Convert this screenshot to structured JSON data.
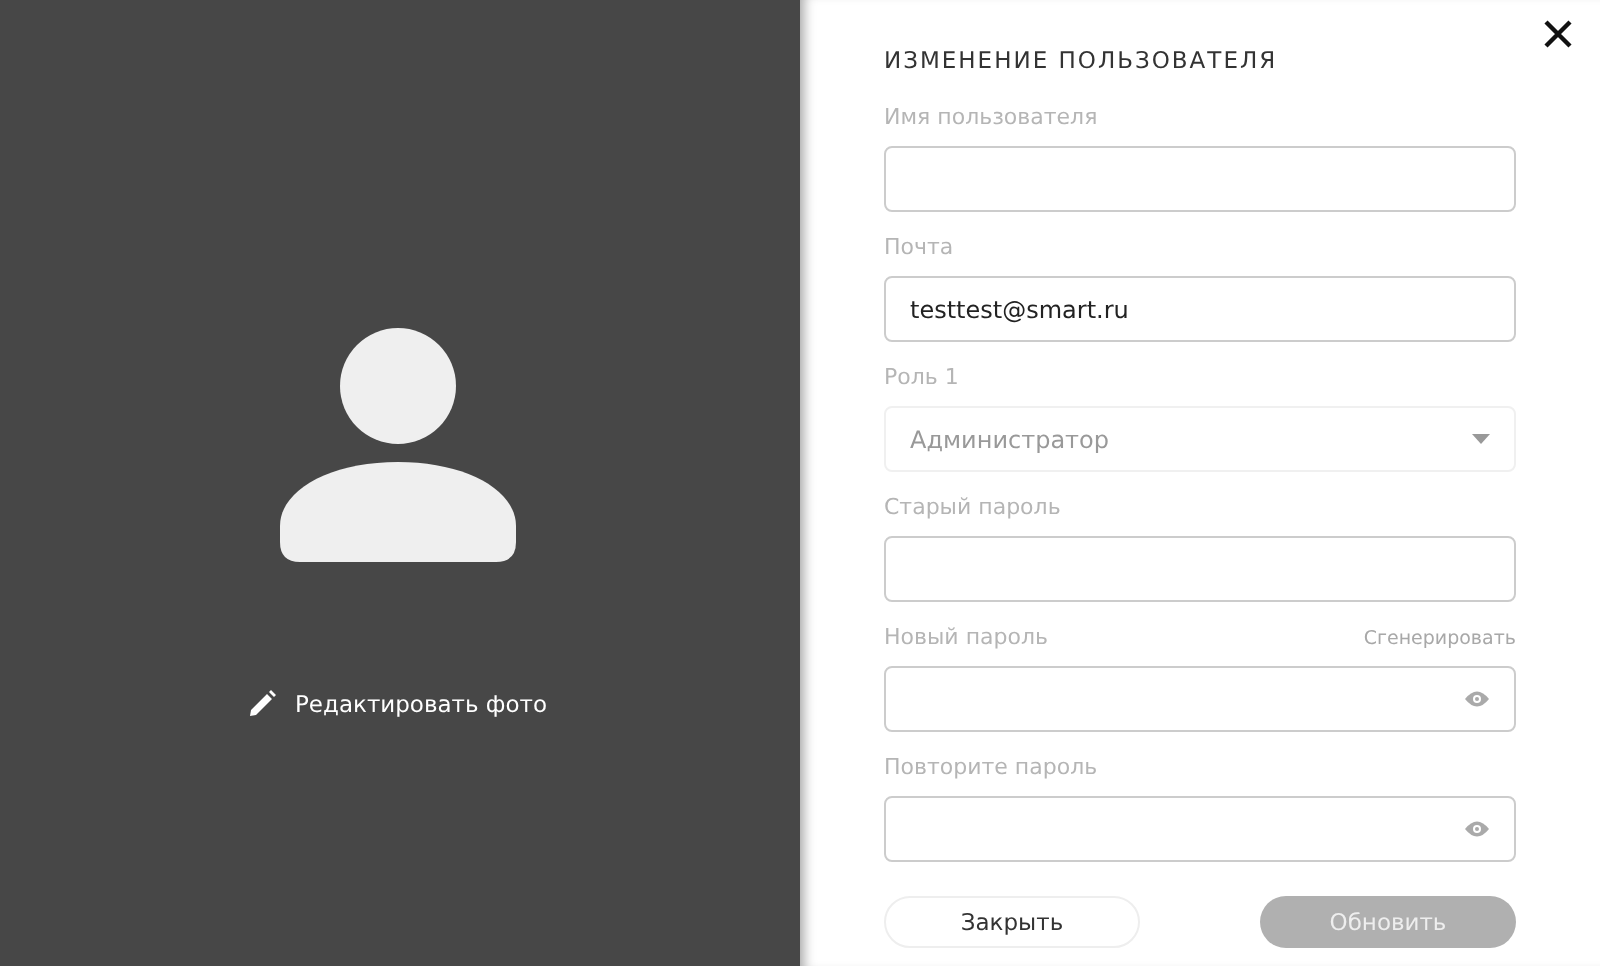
{
  "photo_panel": {
    "edit_label": "Редактировать фото"
  },
  "form": {
    "title": "ИЗМЕНЕНИЕ ПОЛЬЗОВАТЕЛЯ",
    "fields": [
      {
        "kind": "text",
        "label": "Имя пользователя"
      },
      {
        "kind": "text",
        "label": "Почта",
        "value": "testtest@smart.ru"
      },
      {
        "kind": "select",
        "label": "Роль 1",
        "value": "Администратор"
      },
      {
        "kind": "password",
        "label": "Старый пароль"
      },
      {
        "kind": "password",
        "label": "Новый пароль",
        "action": "Сгенерировать",
        "reveal": true
      },
      {
        "kind": "password",
        "label": "Повторите пароль",
        "reveal": true
      }
    ],
    "buttons": [
      {
        "label": "Закрыть",
        "disabled": false
      },
      {
        "label": "Обновить",
        "disabled": true
      }
    ]
  }
}
